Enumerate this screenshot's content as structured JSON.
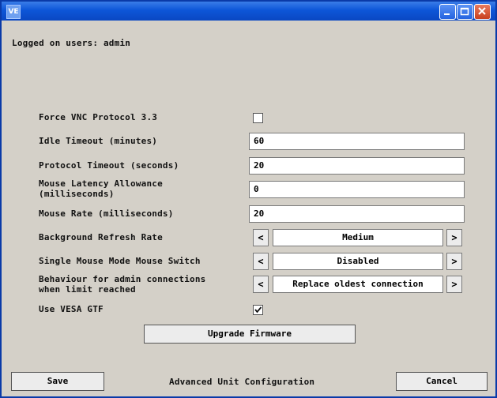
{
  "window": {
    "icon_label": "VE"
  },
  "header": {
    "logged_on": "Logged on users: admin"
  },
  "settings": {
    "force_vnc": {
      "label": "Force VNC Protocol 3.3",
      "checked": false
    },
    "idle_timeout": {
      "label": "Idle Timeout (minutes)",
      "value": "60"
    },
    "protocol_timeout": {
      "label": "Protocol Timeout (seconds)",
      "value": "20"
    },
    "mouse_latency": {
      "label": "Mouse Latency Allowance\n(milliseconds)",
      "value": "0"
    },
    "mouse_rate": {
      "label": "Mouse Rate (milliseconds)",
      "value": "20"
    },
    "background_refresh": {
      "label": "Background Refresh Rate",
      "value": "Medium"
    },
    "single_mouse_mode": {
      "label": "Single Mouse Mode Mouse Switch",
      "value": "Disabled"
    },
    "admin_behaviour": {
      "label": "Behaviour for admin connections\nwhen limit reached",
      "value": "Replace oldest connection"
    },
    "use_vesa_gtf": {
      "label": "Use VESA GTF",
      "checked": true
    }
  },
  "arrows": {
    "left": "<",
    "right": ">"
  },
  "buttons": {
    "upgrade": "Upgrade Firmware",
    "save": "Save",
    "cancel": "Cancel"
  },
  "footer": {
    "title": "Advanced Unit Configuration"
  }
}
